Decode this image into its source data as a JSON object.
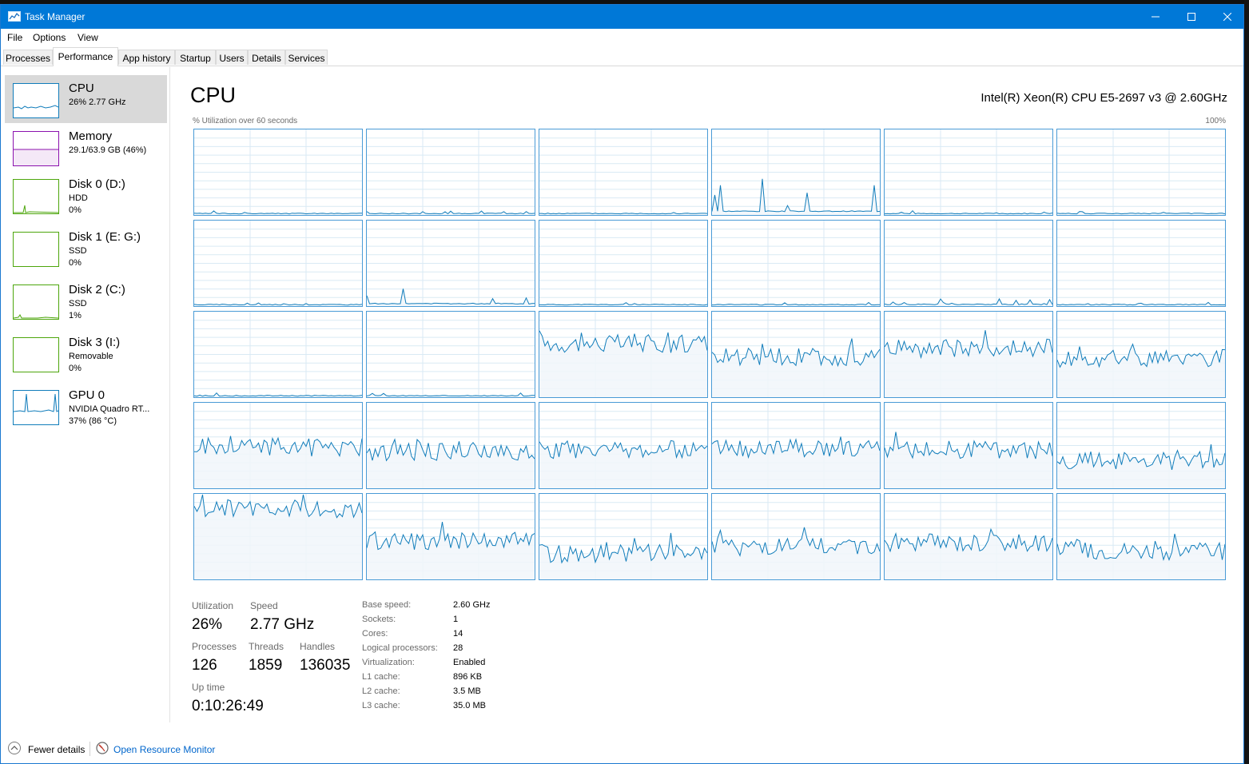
{
  "window": {
    "title": "Task Manager"
  },
  "menu": [
    "File",
    "Options",
    "View"
  ],
  "tabs": [
    "Processes",
    "Performance",
    "App history",
    "Startup",
    "Users",
    "Details",
    "Services"
  ],
  "active_tab": "Performance",
  "sidebar": {
    "items": [
      {
        "name": "CPU",
        "lines": [
          "26% 2.77 GHz"
        ],
        "color": "#117dbb",
        "selected": true,
        "usage": 0.26
      },
      {
        "name": "Memory",
        "lines": [
          "29.1/63.9 GB (46%)"
        ],
        "color": "#8b12ae",
        "selected": false,
        "usage": 0.46
      },
      {
        "name": "Disk 0 (D:)",
        "lines": [
          "HDD",
          "0%"
        ],
        "color": "#4da60c",
        "selected": false,
        "usage": 0.0
      },
      {
        "name": "Disk 1 (E: G:)",
        "lines": [
          "SSD",
          "0%"
        ],
        "color": "#4da60c",
        "selected": false,
        "usage": 0.0
      },
      {
        "name": "Disk 2 (C:)",
        "lines": [
          "SSD",
          "1%"
        ],
        "color": "#4da60c",
        "selected": false,
        "usage": 0.01
      },
      {
        "name": "Disk 3 (I:)",
        "lines": [
          "Removable",
          "0%"
        ],
        "color": "#4da60c",
        "selected": false,
        "usage": 0.0
      },
      {
        "name": "GPU 0",
        "lines": [
          "NVIDIA Quadro RT...",
          "37% (86 °C)"
        ],
        "color": "#117dbb",
        "selected": false,
        "usage": 0.37
      }
    ]
  },
  "cpu": {
    "title": "CPU",
    "model": "Intel(R) Xeon(R) CPU E5-2697 v3 @ 2.60GHz",
    "graph_label": "% Utilization over 60 seconds",
    "graph_max": "100%",
    "logical_processor_levels": [
      0.01,
      0.01,
      0.01,
      0.1,
      0.01,
      0.01,
      0.01,
      0.05,
      0.01,
      0.01,
      0.02,
      0.01,
      0.01,
      0.01,
      0.63,
      0.47,
      0.57,
      0.45,
      0.48,
      0.43,
      0.45,
      0.46,
      0.45,
      0.32,
      0.83,
      0.45,
      0.3,
      0.38,
      0.43,
      0.33
    ],
    "stats": {
      "utilization_label": "Utilization",
      "utilization": "26%",
      "speed_label": "Speed",
      "speed": "2.77 GHz",
      "processes_label": "Processes",
      "processes": "126",
      "threads_label": "Threads",
      "threads": "1859",
      "handles_label": "Handles",
      "handles": "136035",
      "uptime_label": "Up time",
      "uptime": "0:10:26:49"
    },
    "info": [
      {
        "label": "Base speed:",
        "value": "2.60 GHz"
      },
      {
        "label": "Sockets:",
        "value": "1"
      },
      {
        "label": "Cores:",
        "value": "14"
      },
      {
        "label": "Logical processors:",
        "value": "28"
      },
      {
        "label": "Virtualization:",
        "value": "Enabled"
      },
      {
        "label": "L1 cache:",
        "value": "896 KB"
      },
      {
        "label": "L2 cache:",
        "value": "3.5 MB"
      },
      {
        "label": "L3 cache:",
        "value": "35.0 MB"
      }
    ]
  },
  "footer": {
    "fewer_details": "Fewer details",
    "open_resource_monitor": "Open Resource Monitor"
  },
  "colors": {
    "titlebar": "#0078d7",
    "cpu_line": "#117dbb",
    "cpu_fill": "#f1f6fa",
    "grid": "#d9eaf4"
  }
}
